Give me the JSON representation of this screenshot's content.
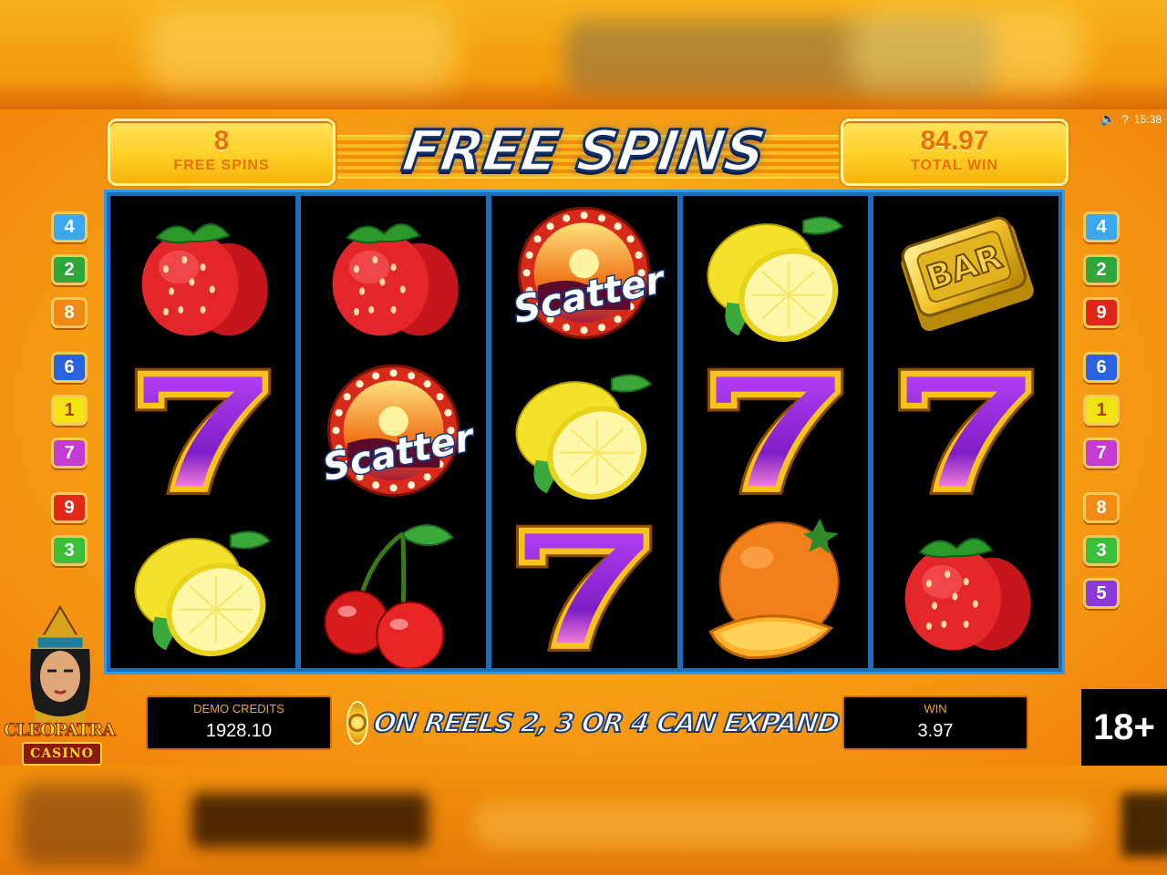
{
  "header": {
    "free_spins_count": "8",
    "free_spins_label": "FREE SPINS",
    "title": "FREE SPINS",
    "total_win_value": "84.97",
    "total_win_label": "TOTAL WIN",
    "clock": "15:38",
    "help": "?"
  },
  "reels": [
    [
      "strawberry",
      "seven",
      "lemon"
    ],
    [
      "strawberry",
      "scatter",
      "cherry"
    ],
    [
      "scatter",
      "lemon",
      "seven"
    ],
    [
      "lemon",
      "seven",
      "orange"
    ],
    [
      "bar",
      "seven",
      "strawberry"
    ]
  ],
  "symbol_text": {
    "scatter": "Scatter",
    "bar": "BAR"
  },
  "paylines": {
    "left": [
      [
        {
          "n": "4",
          "c": "#3aa7f0"
        },
        {
          "n": "2",
          "c": "#2fa63a"
        },
        {
          "n": "8",
          "c": "#f08a12"
        }
      ],
      [
        {
          "n": "6",
          "c": "#2a63e0"
        },
        {
          "n": "1",
          "c": "#f2e414"
        },
        {
          "n": "7",
          "c": "#c63ad8"
        }
      ],
      [
        {
          "n": "9",
          "c": "#e0281a"
        },
        {
          "n": "3",
          "c": "#3bbf3a"
        }
      ]
    ],
    "right": [
      [
        {
          "n": "4",
          "c": "#3aa7f0"
        },
        {
          "n": "2",
          "c": "#2fa63a"
        },
        {
          "n": "9",
          "c": "#e0281a"
        }
      ],
      [
        {
          "n": "6",
          "c": "#2a63e0"
        },
        {
          "n": "1",
          "c": "#f2e414"
        },
        {
          "n": "7",
          "c": "#c63ad8"
        }
      ],
      [
        {
          "n": "8",
          "c": "#f08a12"
        },
        {
          "n": "3",
          "c": "#3bbf3a"
        },
        {
          "n": "5",
          "c": "#8a3ad8"
        }
      ]
    ]
  },
  "footer": {
    "credits_label": "DEMO CREDITS",
    "credits_value": "1928.10",
    "message": "ON REELS 2, 3 OR 4 CAN EXPAND",
    "win_label": "WIN",
    "win_value": "3.97",
    "age_badge": "18+"
  },
  "logo": {
    "line1": "CLEOPATRA",
    "line2": "CASINO"
  }
}
